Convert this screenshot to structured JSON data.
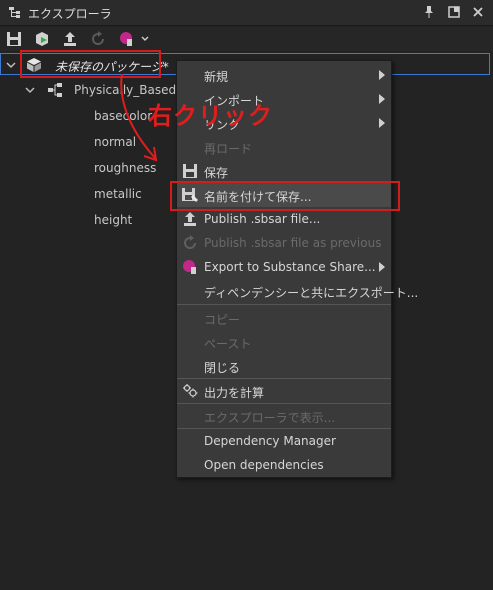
{
  "window": {
    "title": "エクスプローラ"
  },
  "tree": {
    "package_label": "未保存のパッケージ*",
    "graph_label": "Physically_Based_M",
    "outputs": [
      "basecolor",
      "normal",
      "roughness",
      "metallic",
      "height"
    ]
  },
  "annotation": {
    "text": "右クリック"
  },
  "context_menu": {
    "items": [
      {
        "label": "新規",
        "disabled": false,
        "submenu": true
      },
      {
        "label": "インポート",
        "disabled": false,
        "submenu": true
      },
      {
        "label": "リンク",
        "disabled": false,
        "submenu": true
      },
      {
        "label": "再ロード",
        "disabled": true,
        "submenu": false
      },
      {
        "label": "保存",
        "disabled": false,
        "submenu": false,
        "icon": "save-icon"
      },
      {
        "label": "名前を付けて保存...",
        "disabled": false,
        "submenu": false,
        "icon": "save-as-icon",
        "highlighted": true
      },
      {
        "label": "Publish .sbsar file...",
        "disabled": false,
        "submenu": false,
        "icon": "upload-icon"
      },
      {
        "label": "Publish .sbsar file as previous",
        "disabled": true,
        "submenu": false,
        "icon": "republish-icon"
      },
      {
        "label": "Export to Substance Share...",
        "disabled": false,
        "submenu": true,
        "icon": "substance-share-icon"
      },
      {
        "label": "ディペンデンシーと共にエクスポート...",
        "disabled": false,
        "submenu": false
      },
      {
        "label": "コピー",
        "disabled": true,
        "submenu": false
      },
      {
        "label": "ペースト",
        "disabled": true,
        "submenu": false
      },
      {
        "label": "閉じる",
        "disabled": false,
        "submenu": false
      },
      {
        "label": "出力を計算",
        "disabled": false,
        "submenu": false,
        "icon": "compute-icon"
      },
      {
        "label": "エクスプローラで表示...",
        "disabled": true,
        "submenu": false
      },
      {
        "label": "Dependency Manager",
        "disabled": false,
        "submenu": false
      },
      {
        "label": "Open dependencies",
        "disabled": false,
        "submenu": false
      }
    ]
  },
  "colors": {
    "accent_red": "#d41c1c",
    "selection_blue": "#3d7ad6",
    "substance_pink": "#c2278a"
  }
}
